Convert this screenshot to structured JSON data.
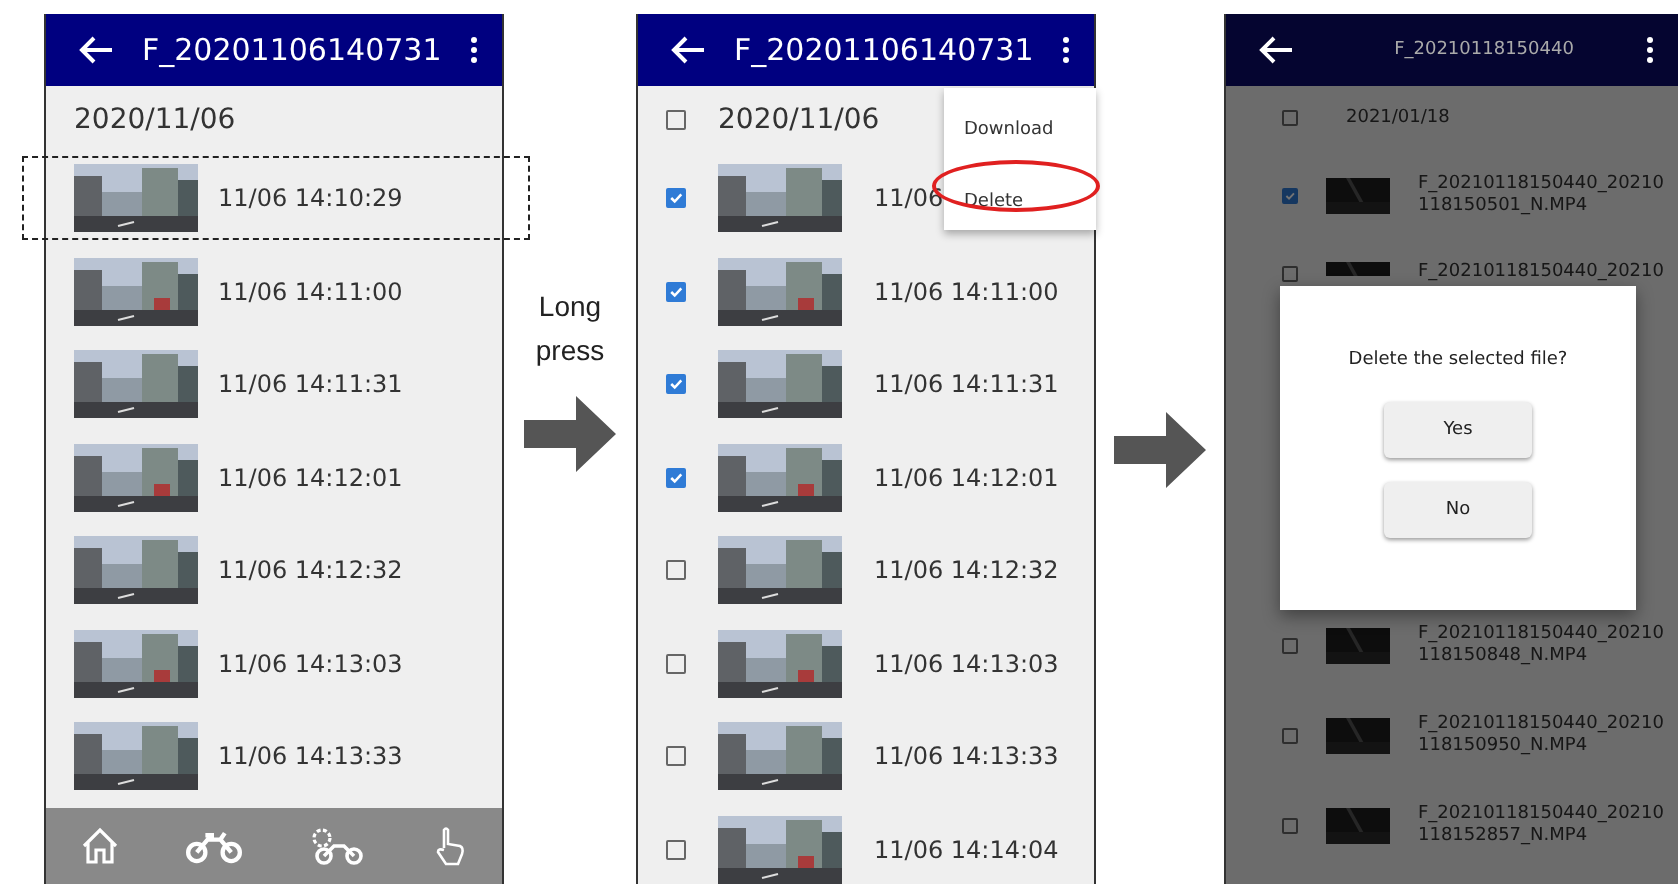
{
  "screens": [
    {
      "kind": "browse",
      "title": "F_20201106140731",
      "date": "2020/11/06",
      "highlight_first_row": true,
      "rows": [
        {
          "time": "11/06 14:10:29"
        },
        {
          "time": "11/06 14:11:00"
        },
        {
          "time": "11/06 14:11:31"
        },
        {
          "time": "11/06 14:12:01"
        },
        {
          "time": "11/06 14:12:32"
        },
        {
          "time": "11/06 14:13:03"
        },
        {
          "time": "11/06 14:13:33"
        }
      ]
    },
    {
      "kind": "select",
      "title": "F_20201106140731",
      "date": "2020/11/06",
      "date_checked": false,
      "rows": [
        {
          "time": "11/06",
          "checked": true
        },
        {
          "time": "11/06 14:11:00",
          "checked": true
        },
        {
          "time": "11/06 14:11:31",
          "checked": true
        },
        {
          "time": "11/06 14:12:01",
          "checked": true
        },
        {
          "time": "11/06 14:12:32",
          "checked": false
        },
        {
          "time": "11/06 14:13:03",
          "checked": false
        },
        {
          "time": "11/06 14:13:33",
          "checked": false
        },
        {
          "time": "11/06 14:14:04",
          "checked": false
        }
      ],
      "menu": [
        {
          "label": "Download",
          "circled": false
        },
        {
          "label": "Delete",
          "circled": true
        }
      ]
    },
    {
      "kind": "confirm",
      "title": "F_20210118150440",
      "date": "2021/01/18",
      "date_checked": false,
      "rows": [
        {
          "name": [
            "F_20210118150440_20210",
            "118150501_N.MP4"
          ],
          "checked": true
        },
        {
          "name": [
            "F_20210118150440_20210"
          ],
          "checked": false
        }
      ],
      "rows_below_dialog": [
        {
          "name": [
            "F_20210118150440_20210",
            "118150848_N.MP4"
          ],
          "checked": false
        },
        {
          "name": [
            "F_20210118150440_20210",
            "118150950_N.MP4"
          ],
          "checked": false
        },
        {
          "name": [
            "F_20210118150440_20210",
            "118152857_N.MP4"
          ],
          "checked": false
        }
      ],
      "dialog": {
        "message": "Delete the selected file?",
        "buttons": [
          "Yes",
          "No"
        ]
      }
    }
  ],
  "steps": [
    {
      "label": [
        "Long",
        "press"
      ]
    }
  ]
}
